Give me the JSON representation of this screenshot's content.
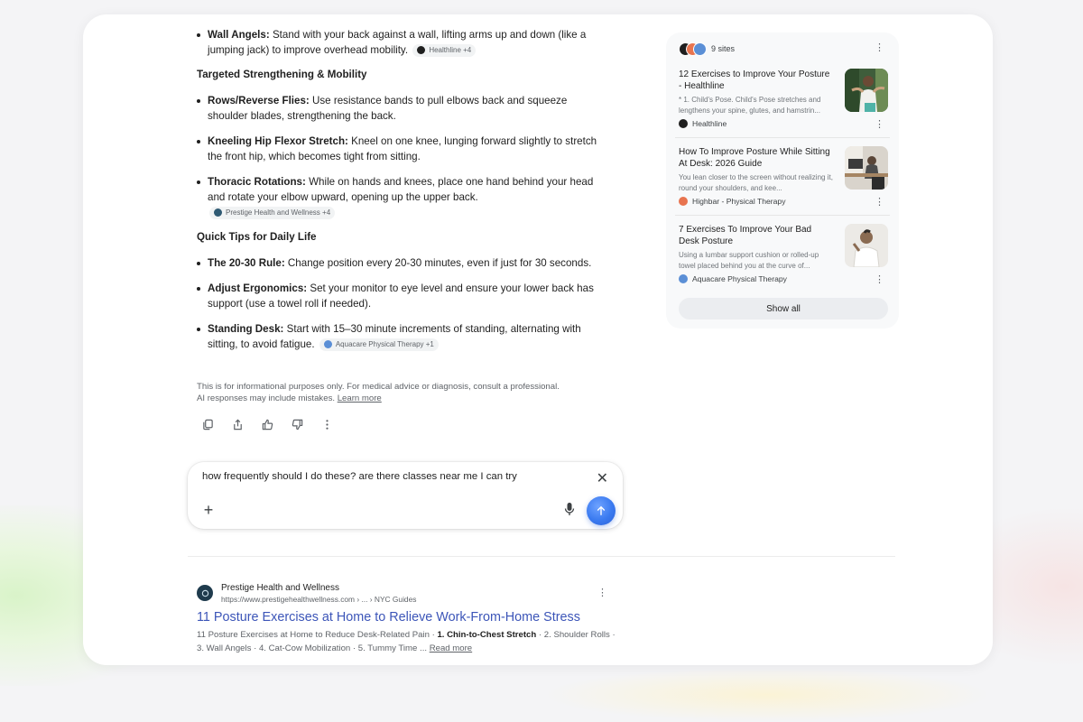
{
  "steps": [
    {
      "label": "Wall Angels:",
      "text": " Stand with your back against a wall, lifting arms up and down (like a jumping jack) to improve overhead mobility.",
      "chip": "Healthline +4",
      "chip_color": "#1f1f1f"
    }
  ],
  "sections": [
    {
      "heading": "Targeted Strengthening & Mobility",
      "items": [
        {
          "label": "Rows/Reverse Flies:",
          "text": " Use resistance bands to pull elbows back and squeeze shoulder blades, strengthening the back."
        },
        {
          "label": "Kneeling Hip Flexor Stretch:",
          "text": "  Kneel on one knee, lunging forward slightly to stretch the front hip, which becomes tight from sitting."
        },
        {
          "label": "Thoracic Rotations:",
          "text": " While on hands and knees, place one hand behind your head and rotate your elbow upward, opening up the upper back.",
          "chip": "Prestige Health and Wellness +4",
          "chip_color": "#2f5a73"
        }
      ]
    },
    {
      "heading": "Quick Tips for Daily Life",
      "items": [
        {
          "label": "The 20-30 Rule:",
          "text": " Change position every 20-30 minutes, even if just for 30 seconds."
        },
        {
          "label": "Adjust Ergonomics:",
          "text": " Set your monitor to eye level and ensure your lower back has support (use a towel roll if needed)."
        },
        {
          "label": "Standing Desk:",
          "text": " Start with 15–30 minute increments of standing, alternating with sitting, to avoid fatigue.",
          "chip": "Aquacare Physical Therapy +1",
          "chip_color": "#5b8fd6"
        }
      ]
    }
  ],
  "disclaimer": {
    "line1": "This is for informational purposes only. For medical advice or diagnosis, consult a professional.",
    "line2": "AI responses may include mistakes. ",
    "link": "Learn more"
  },
  "actions": [
    "copy-icon",
    "share-icon",
    "thumbs-up-icon",
    "thumbs-down-icon",
    "more-vert-icon"
  ],
  "chat": {
    "value": "how frequently should I do these? are there classes near me I can try",
    "close": "✕",
    "plus": "+"
  },
  "result": {
    "site_name": "Prestige Health and Wellness",
    "url": "https://www.prestigehealthwellness.com › ... › NYC Guides",
    "title": "11 Posture Exercises at Home to Relieve Work-From-Home Stress",
    "snippet_a": "11 Posture Exercises at Home to Reduce Desk-Related Pain · ",
    "snippet_b": "1. Chin-to-Chest Stretch",
    "snippet_c": " · 2. Shoulder Rolls · 3. Wall Angels · 4. Cat-Cow Mobilization · 5. Tummy Time ... ",
    "read_more": "Read more"
  },
  "panel": {
    "sites_count": "9 sites",
    "show_all": "Show all",
    "sources": [
      {
        "title": "12 Exercises to Improve Your Posture - Healthline",
        "desc": "* 1. Child's Pose. Child's Pose stretches and lengthens your spine, glutes, and hamstrin...",
        "site": "Healthline",
        "site_color": "#1f1f1f"
      },
      {
        "title": "How To Improve Posture While Sitting At Desk: 2026 Guide",
        "desc": "You lean closer to the screen without realizing it, round your shoulders, and kee...",
        "site": "Highbar - Physical Therapy",
        "site_color": "#e8744f"
      },
      {
        "title": "7 Exercises To Improve Your Bad Desk Posture",
        "desc": "Using a lumbar support cushion or rolled-up towel placed behind you at the curve of...",
        "site": "Aquacare Physical Therapy",
        "site_color": "#5b8fd6"
      }
    ]
  }
}
